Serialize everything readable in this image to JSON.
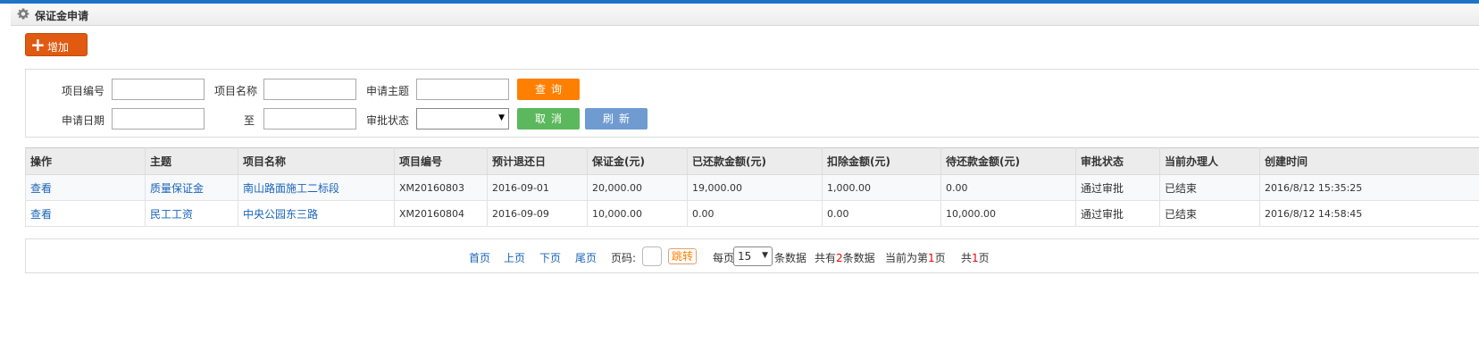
{
  "header": {
    "title": "保证金申请"
  },
  "toolbar": {
    "add_label": "增加"
  },
  "search": {
    "project_code_label": "项目编号",
    "project_code_value": "",
    "project_name_label": "项目名称",
    "project_name_value": "",
    "subject_label": "申请主题",
    "subject_value": "",
    "apply_date_label": "申请日期",
    "apply_date_from": "",
    "to_label": "至",
    "apply_date_to": "",
    "status_label": "审批状态",
    "status_value": "",
    "query_label": "查询",
    "cancel_label": "取消",
    "refresh_label": "刷新"
  },
  "table": {
    "columns": [
      "操作",
      "主题",
      "项目名称",
      "项目编号",
      "预计退还日",
      "保证金(元)",
      "已还款金额(元)",
      "扣除金额(元)",
      "待还款金额(元)",
      "审批状态",
      "当前办理人",
      "创建时间"
    ],
    "rows": [
      [
        "查看",
        "质量保证金",
        "南山路面施工二标段",
        "XM20160803",
        "2016-09-01",
        "20,000.00",
        "19,000.00",
        "1,000.00",
        "0.00",
        "通过审批",
        "已结束",
        "2016/8/12 15:35:25"
      ],
      [
        "查看",
        "民工工资",
        "中央公园东三路",
        "XM20160804",
        "2016-09-09",
        "10,000.00",
        "0.00",
        "0.00",
        "10,000.00",
        "通过审批",
        "已结束",
        "2016/8/12 14:58:45"
      ]
    ]
  },
  "pager": {
    "first": "首页",
    "prev": "上页",
    "next": "下页",
    "last": "尾页",
    "page_label": "页码:",
    "page_value": "",
    "jump_label": "跳转",
    "per_page_prefix": "每页",
    "per_page_value": "15",
    "per_page_suffix": "条数据",
    "total_prefix": "共有",
    "total_count": "2",
    "total_suffix": "条数据",
    "current_prefix": "当前为第",
    "current_page": "1",
    "current_suffix": "页",
    "pages_prefix": "共",
    "pages_count": "1",
    "pages_suffix": "页"
  },
  "colors": {
    "accent": "#1e73c9",
    "add_button": "#e05a12",
    "query": "#ff7f00",
    "cancel": "#5cb85c",
    "refresh": "#6f9bd1",
    "link": "#1a64b8"
  },
  "icons": {
    "title": "gear-icon",
    "add": "plus-icon",
    "select": "dropdown-arrow-icon"
  }
}
